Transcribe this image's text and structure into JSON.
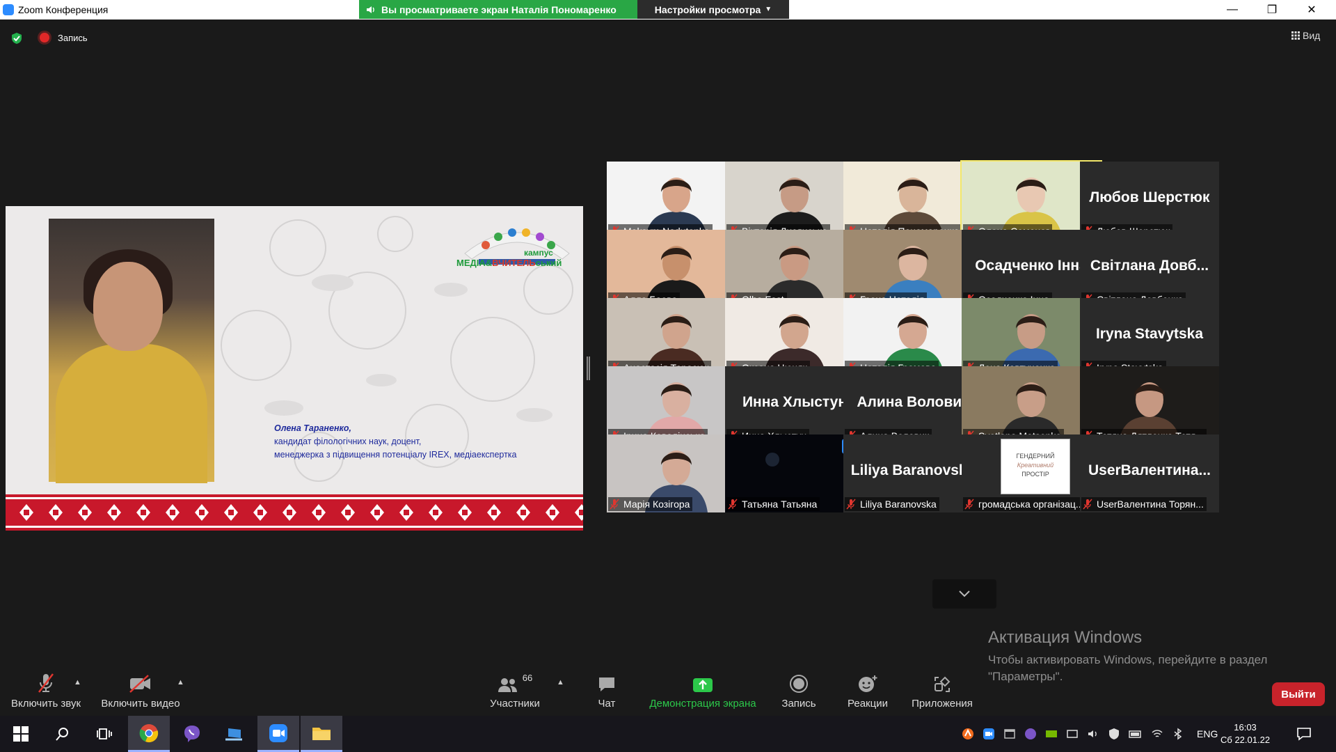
{
  "window": {
    "title": "Zoom Конференция",
    "share_banner": "Вы просматриваете экран Наталія Пономаренко",
    "view_options": "Настройки просмотра"
  },
  "top": {
    "record_label": "Запись",
    "view_label": "Вид"
  },
  "slide": {
    "logo_prefix": "кампус",
    "logo_main_a": "МЕДІА&",
    "logo_main_b": "ВЧИТЕЛЬ",
    "logo_main_c": "ський",
    "speaker_name": "Олена Тараненко,",
    "speaker_line2": "кандидат філологічних наук, доцент,",
    "speaker_line3": "менеджерка з підвищення потенціалу IREX, медіаекспертка"
  },
  "participants": [
    {
      "label": "Maksym Nadutenko",
      "big": "",
      "video": "face1"
    },
    {
      "label": "Вікторія Лисянська",
      "big": "",
      "video": "face2"
    },
    {
      "label": "Наталія Пономаренко",
      "big": "",
      "video": "face3"
    },
    {
      "label": "Олена Семеног",
      "big": "",
      "video": "face4"
    },
    {
      "label": "Любов Шерстюк",
      "big": "Любов Шерстюк",
      "video": ""
    },
    {
      "label": "Алла Баева",
      "big": "",
      "video": "face5"
    },
    {
      "label": "Olha Fast",
      "big": "",
      "video": "face6"
    },
    {
      "label": "Грона Наталія",
      "big": "",
      "video": "face7"
    },
    {
      "label": "Осадченко Інна",
      "big": "Осадченко Інна",
      "video": ""
    },
    {
      "label": "Світлана  Довбенко",
      "big": "Світлана  Довб...",
      "video": ""
    },
    {
      "label": "Анастасія Тарасюк",
      "big": "",
      "video": "face8"
    },
    {
      "label": "Оксана Цюняк",
      "big": "",
      "video": "face9"
    },
    {
      "label": "Наталія Громова",
      "big": "",
      "video": "face10"
    },
    {
      "label": "Лена   Ковтуненко",
      "big": "",
      "video": "face11"
    },
    {
      "label": "Iryna Stavytska",
      "big": "Iryna Stavytska",
      "video": ""
    },
    {
      "label": "Ірина Ковалінська",
      "big": "",
      "video": "face12"
    },
    {
      "label": "Инна Хлыстун",
      "big": "Инна Хлыстун",
      "video": ""
    },
    {
      "label": "Алина Воловик",
      "big": "Алина Воловик",
      "video": ""
    },
    {
      "label": "Svetlana Matsenko",
      "big": "",
      "video": "face13"
    },
    {
      "label": "Тетяна Дятленко Тетя...",
      "big": "",
      "video": "face14"
    },
    {
      "label": "Марія Козігора",
      "big": "",
      "video": "face15"
    },
    {
      "label": "Татьяна Татьяна",
      "big": "",
      "video": "dark"
    },
    {
      "label": "Liliya Baranovska",
      "big": "Liliya Baranovska",
      "video": ""
    },
    {
      "label": "громадська організац...",
      "big": "",
      "video": "logo"
    },
    {
      "label": "UserВалентина Торян...",
      "big": "UserВалентина...",
      "video": ""
    }
  ],
  "logo_tile_text": {
    "l1": "ГЕНДЕРНИЙ",
    "l2": "Креативний",
    "l3": "ПРОСТІР"
  },
  "more_label": "···",
  "activation": {
    "title": "Активация Windows",
    "line1": "Чтобы активировать Windows, перейдите в раздел",
    "line2": "\"Параметры\"."
  },
  "toolbar": {
    "unmute": "Включить звук",
    "start_video": "Включить видео",
    "participants": "Участники",
    "participants_count": "66",
    "chat": "Чат",
    "share": "Демонстрация экрана",
    "record": "Запись",
    "reactions": "Реакции",
    "apps": "Приложения",
    "leave": "Выйти"
  },
  "taskbar": {
    "lang": "ENG",
    "time": "16:03",
    "date": "Сб 22.01.22"
  },
  "colors": {
    "share_green": "#29a745",
    "leave_red": "#c8232b",
    "active_speaker": "#f3e76a",
    "accent_blue": "#2d8cff"
  }
}
